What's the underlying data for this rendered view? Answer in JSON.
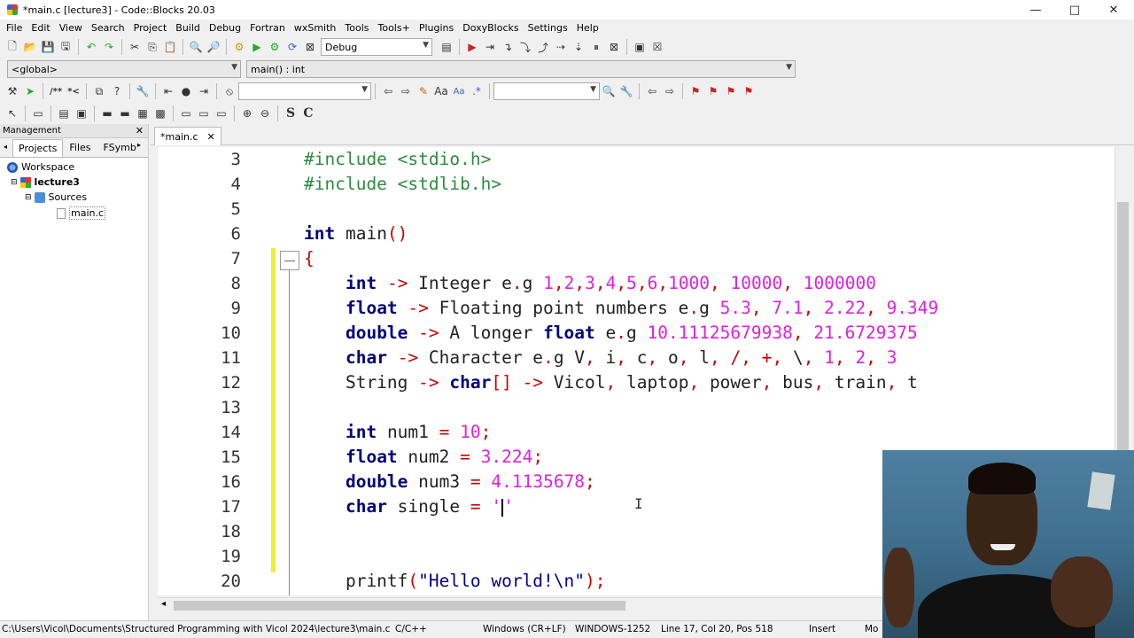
{
  "window": {
    "title": "*main.c [lecture3] - Code::Blocks 20.03",
    "min_label": "—",
    "max_label": "□",
    "close_label": "✕"
  },
  "menu": [
    "File",
    "Edit",
    "View",
    "Search",
    "Project",
    "Build",
    "Debug",
    "Fortran",
    "wxSmith",
    "Tools",
    "Tools+",
    "Plugins",
    "DoxyBlocks",
    "Settings",
    "Help"
  ],
  "toolbar": {
    "build_target": "Debug",
    "scope": "<global>",
    "function": "main() : int",
    "search_value": "",
    "search2_value": ""
  },
  "management": {
    "title": "Management",
    "close": "✕",
    "tabs": [
      "Projects",
      "Files",
      "FSymb"
    ],
    "tree": {
      "workspace": "Workspace",
      "project": "lecture3",
      "folder": "Sources",
      "file": "main.c"
    }
  },
  "editor": {
    "tab_label": "*main.c",
    "tab_close": "✕",
    "line_numbers": [
      "3",
      "4",
      "5",
      "6",
      "7",
      "8",
      "9",
      "10",
      "11",
      "12",
      "13",
      "14",
      "15",
      "16",
      "17",
      "18",
      "19",
      "20"
    ]
  },
  "status": {
    "path": "C:\\Users\\Vicol\\Documents\\Structured Programming with Vicol 2024\\lecture3\\main.c",
    "language": "C/C++",
    "eol": "Windows (CR+LF)",
    "encoding": "WINDOWS-1252",
    "position": "Line 17, Col 20, Pos 518",
    "mode": "Insert",
    "extra": "Mo"
  }
}
